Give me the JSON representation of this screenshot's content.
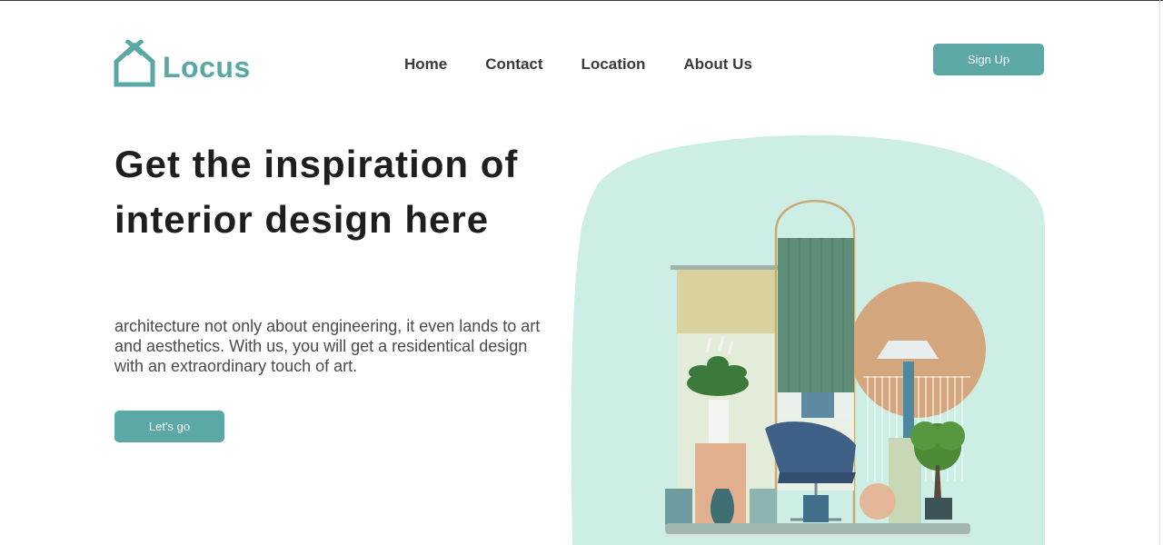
{
  "brand": {
    "name": "Locus",
    "icon": "house-icon",
    "color": "#5aa8a5"
  },
  "nav": {
    "items": [
      {
        "label": "Home"
      },
      {
        "label": "Contact"
      },
      {
        "label": "Location"
      },
      {
        "label": "About Us"
      }
    ]
  },
  "header": {
    "signup_label": "Sign Up"
  },
  "hero": {
    "headline": "Get the inspiration of interior design here",
    "description": "architecture not only about engineering, it even lands to art and aesthetics. With us, you will get a residentical design with an extraordinary touch of art.",
    "cta_label": "Let's go",
    "illustration": "interior-design-illustration"
  },
  "colors": {
    "accent": "#5ba8a4",
    "mint_background": "#cdeee5",
    "heading": "#1e1e1e"
  }
}
